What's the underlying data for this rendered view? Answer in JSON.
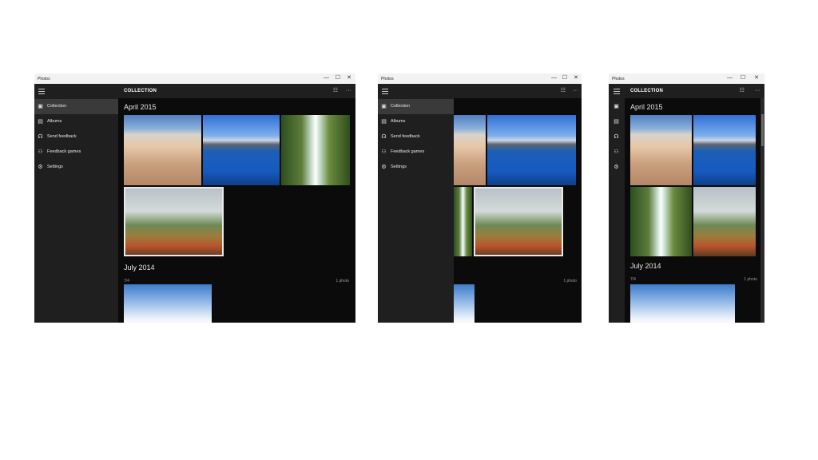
{
  "app": {
    "window_title": "Photos",
    "header_title": "COLLECTION",
    "controls": {
      "minimize": "—",
      "maximize": "☐",
      "close": "✕"
    }
  },
  "nav": {
    "items": [
      {
        "label": "Collection",
        "icon": "collection-icon",
        "selected": true
      },
      {
        "label": "Albums",
        "icon": "albums-icon",
        "selected": false
      },
      {
        "label": "Send feedback",
        "icon": "feedback-icon",
        "selected": false
      },
      {
        "label": "Feedback games",
        "icon": "people-icon",
        "selected": false
      },
      {
        "label": "Settings",
        "icon": "gear-icon",
        "selected": false
      }
    ]
  },
  "groups": {
    "april": {
      "title": "April 2015"
    },
    "july": {
      "title": "July 2014",
      "date": "7/4",
      "count": "1 photo"
    }
  },
  "icons": {
    "hamburger": "☰",
    "select": "☷",
    "more": "···"
  },
  "colors": {
    "background": "#0b0b0b",
    "pane": "#1f1f1f",
    "selected_nav": "#3a3a3a",
    "text": "#e6e6e6"
  }
}
